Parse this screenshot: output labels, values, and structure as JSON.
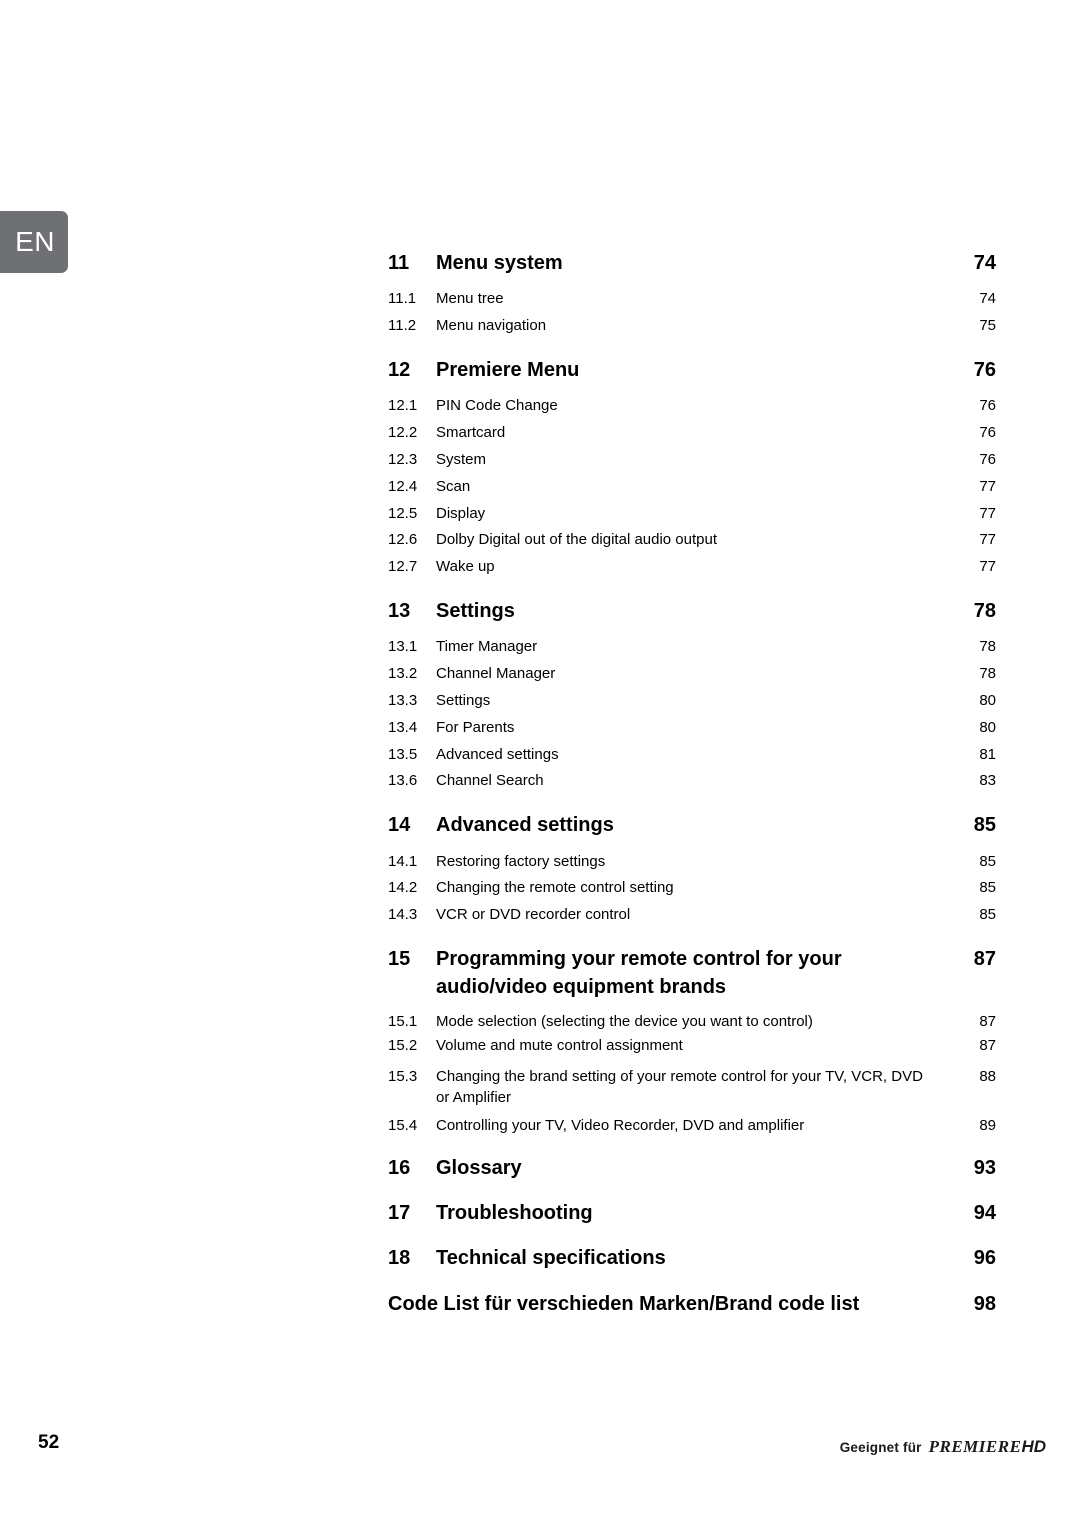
{
  "language_tab": {
    "label": "EN"
  },
  "colors": {
    "tab_background": "#6f7073",
    "text": "#000000"
  },
  "toc": {
    "entries": [
      {
        "type": "chapter",
        "num": "11",
        "title": "Menu system",
        "page": "74"
      },
      {
        "type": "sub",
        "num": "11.1",
        "title": "Menu tree",
        "page": "74"
      },
      {
        "type": "sub",
        "num": "11.2",
        "title": "Menu navigation",
        "page": "75"
      },
      {
        "type": "chapter",
        "num": "12",
        "title": "Premiere Menu",
        "page": "76"
      },
      {
        "type": "sub",
        "num": "12.1",
        "title": "PIN Code Change",
        "page": "76"
      },
      {
        "type": "sub",
        "num": "12.2",
        "title": "Smartcard",
        "page": "76"
      },
      {
        "type": "sub",
        "num": "12.3",
        "title": "System",
        "page": "76"
      },
      {
        "type": "sub",
        "num": "12.4",
        "title": "Scan",
        "page": "77"
      },
      {
        "type": "sub",
        "num": "12.5",
        "title": "Display",
        "page": "77"
      },
      {
        "type": "sub",
        "num": "12.6",
        "title": "Dolby Digital out of the digital audio output",
        "page": "77"
      },
      {
        "type": "sub",
        "num": "12.7",
        "title": "Wake up",
        "page": "77"
      },
      {
        "type": "chapter",
        "num": "13",
        "title": "Settings",
        "page": "78"
      },
      {
        "type": "sub",
        "num": "13.1",
        "title": "Timer Manager",
        "page": "78"
      },
      {
        "type": "sub",
        "num": "13.2",
        "title": "Channel Manager",
        "page": "78"
      },
      {
        "type": "sub",
        "num": "13.3",
        "title": "Settings",
        "page": "80"
      },
      {
        "type": "sub",
        "num": "13.4",
        "title": "For Parents",
        "page": "80"
      },
      {
        "type": "sub",
        "num": "13.5",
        "title": "Advanced settings",
        "page": "81"
      },
      {
        "type": "sub",
        "num": "13.6",
        "title": "Channel Search",
        "page": "83"
      },
      {
        "type": "chapter",
        "num": "14",
        "title": "Advanced settings",
        "page": "85"
      },
      {
        "type": "sub",
        "num": "14.1",
        "title": "Restoring factory settings",
        "page": "85"
      },
      {
        "type": "sub",
        "num": "14.2",
        "title": "Changing the remote control setting",
        "page": "85"
      },
      {
        "type": "sub",
        "num": "14.3",
        "title": "VCR or DVD recorder control",
        "page": "85"
      },
      {
        "type": "chapter",
        "num": "15",
        "title": "Programming your remote control for your audio/video equipment brands",
        "page": "87"
      },
      {
        "type": "sub",
        "num": "15.1",
        "title": "Mode selection (selecting the device you want to control)",
        "page": "87"
      },
      {
        "type": "sub",
        "num": "15.2",
        "title": "Volume and mute control assignment",
        "page": "87"
      },
      {
        "type": "sub",
        "num": "15.3",
        "title": "Changing the brand setting of your remote control for your TV, VCR, DVD or Amplifier",
        "page": "88"
      },
      {
        "type": "sub",
        "num": "15.4",
        "title": "Controlling your TV, Video Recorder, DVD and amplifier",
        "page": "89"
      },
      {
        "type": "chapter",
        "num": "16",
        "title": "Glossary",
        "page": "93"
      },
      {
        "type": "chapter",
        "num": "17",
        "title": "Troubleshooting",
        "page": "94"
      },
      {
        "type": "chapter",
        "num": "18",
        "title": "Technical specifications",
        "page": "96"
      },
      {
        "type": "chapter",
        "num": "",
        "title": "Code List für verschieden Marken/Brand code list",
        "page": "98"
      }
    ]
  },
  "footer": {
    "folio": "52",
    "brand_prefix": "Geeignet für",
    "brand_name": "PREMIERE",
    "brand_suffix": "HD"
  }
}
